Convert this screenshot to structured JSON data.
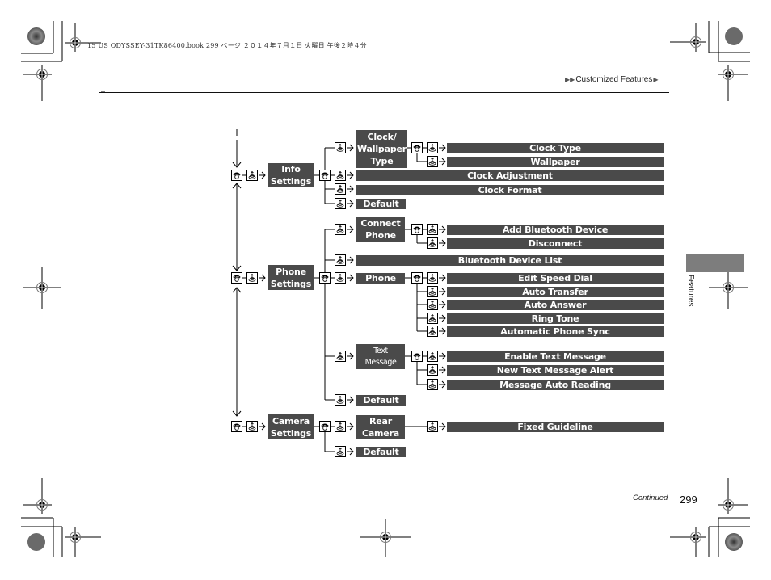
{
  "print_header": {
    "text": "15 US ODYSSEY-31TK86400.book  299 ページ  ２０１４年７月１日  火曜日  午後２時４分"
  },
  "breadcrumb": {
    "prefix_icon": "double-triangle-right-icon",
    "label": "Customized Features",
    "suffix_icon": "triangle-right-icon"
  },
  "side_tab": {
    "label": "Features"
  },
  "footer": {
    "continued": "Continued",
    "page_number": "299"
  },
  "icons": {
    "phone_button": "phone-button-icon",
    "selector_knob": "selector-knob-icon",
    "arrow": "arrow-right-icon"
  },
  "diagram": {
    "info": {
      "label_line1": "Info",
      "label_line2": "Settings",
      "children": {
        "clock_wallpaper": {
          "line1": "Clock/",
          "line2": "Wallpaper",
          "line3": "Type",
          "children": [
            "Clock Type",
            "Wallpaper"
          ]
        },
        "clock_adjustment": "Clock Adjustment",
        "clock_format": "Clock Format",
        "default": "Default"
      }
    },
    "phone": {
      "label_line1": "Phone",
      "label_line2": "Settings",
      "children": {
        "connect_phone": {
          "line1": "Connect",
          "line2": "Phone",
          "children": [
            "Add Bluetooth Device",
            "Disconnect"
          ]
        },
        "bluetooth_device_list": "Bluetooth Device List",
        "phone": {
          "label": "Phone",
          "children": [
            "Edit Speed Dial",
            "Auto Transfer",
            "Auto Answer",
            "Ring Tone",
            "Automatic Phone Sync"
          ]
        },
        "text_message": {
          "line1": "Text",
          "line2": "Message",
          "children": [
            "Enable Text Message",
            "New Text Message Alert",
            "Message Auto Reading"
          ]
        },
        "default": "Default"
      }
    },
    "camera": {
      "label_line1": "Camera",
      "label_line2": "Settings",
      "children": {
        "rear_camera": {
          "line1": "Rear",
          "line2": "Camera",
          "children": [
            "Fixed Guideline"
          ]
        },
        "default": "Default"
      }
    }
  }
}
